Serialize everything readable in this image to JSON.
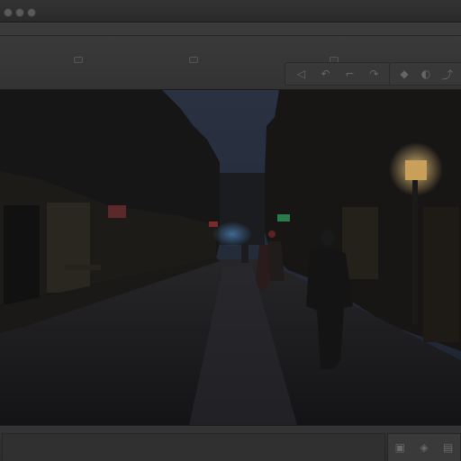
{
  "window": {
    "title": ""
  },
  "toolbar": {
    "left_tools": [
      {
        "icon": "back-icon",
        "glyph": "◁"
      },
      {
        "icon": "rotate-left-icon",
        "glyph": "↶"
      },
      {
        "icon": "crop-icon",
        "glyph": "⌐"
      },
      {
        "icon": "rotate-right-icon",
        "glyph": "↷"
      }
    ],
    "right_tools": [
      {
        "icon": "droplet-icon",
        "glyph": "◆"
      },
      {
        "icon": "adjust-icon",
        "glyph": "◐"
      },
      {
        "icon": "share-icon",
        "glyph": "⤴"
      }
    ]
  },
  "viewer": {
    "image": "night-street-photo",
    "palette": {
      "sky": "#2c3444",
      "buildings": "#151515",
      "street": "#1c1c1e",
      "lamp": "#d9b26a",
      "neon_red": "#8a2a2a",
      "neon_green": "#2a7a4a",
      "neon_blue": "#3a6a9a"
    }
  },
  "bottombar": {
    "tools": [
      {
        "icon": "photo-icon",
        "glyph": "▣"
      },
      {
        "icon": "tag-icon",
        "glyph": "◈"
      },
      {
        "icon": "folder-icon",
        "glyph": "▤"
      }
    ]
  }
}
